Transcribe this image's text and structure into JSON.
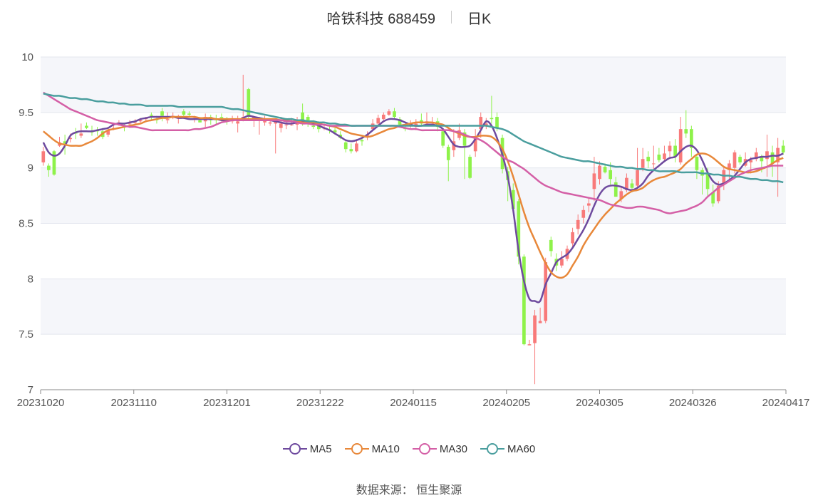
{
  "header": {
    "stock_name": "哈铁科技 688459",
    "period": "日K"
  },
  "source": {
    "label": "数据来源：",
    "value": "恒生聚源"
  },
  "chart_data": {
    "type": "candlestick",
    "y_ticks": [
      "10",
      "9.5",
      "9",
      "8.5",
      "8",
      "7.5",
      "7"
    ],
    "ylim": [
      7,
      10
    ],
    "x_ticks": [
      "20231020",
      "20231110",
      "20231201",
      "20231222",
      "20240115",
      "20240205",
      "20240305",
      "20240326",
      "20240417"
    ],
    "up_color": "#f87a7a",
    "down_color": "#8ef24a",
    "candles": [
      [
        9.05,
        9.15,
        9.19,
        9.02
      ],
      [
        9.02,
        8.98,
        9.04,
        8.92
      ],
      [
        9.15,
        8.94,
        9.16,
        8.93
      ],
      [
        9.2,
        9.23,
        9.28,
        9.19
      ],
      [
        9.24,
        9.22,
        9.3,
        9.12
      ],
      [
        9.26,
        9.27,
        9.31,
        9.23
      ],
      [
        9.32,
        9.31,
        9.36,
        9.26
      ],
      [
        9.29,
        9.31,
        9.4,
        9.27
      ],
      [
        9.38,
        9.36,
        9.41,
        9.35
      ],
      [
        9.33,
        9.32,
        9.38,
        9.29
      ],
      [
        9.34,
        9.33,
        9.37,
        9.29
      ],
      [
        9.33,
        9.28,
        9.36,
        9.26
      ],
      [
        9.3,
        9.34,
        9.37,
        9.28
      ],
      [
        9.36,
        9.36,
        9.39,
        9.34
      ],
      [
        9.41,
        9.41,
        9.43,
        9.38
      ],
      [
        9.38,
        9.37,
        9.4,
        9.33
      ],
      [
        9.4,
        9.4,
        9.43,
        9.36
      ],
      [
        9.41,
        9.41,
        9.44,
        9.38
      ],
      [
        9.42,
        9.43,
        9.45,
        9.41
      ],
      [
        9.44,
        9.45,
        9.46,
        9.42
      ],
      [
        9.48,
        9.47,
        9.5,
        9.43
      ],
      [
        9.44,
        9.43,
        9.47,
        9.4
      ],
      [
        9.51,
        9.47,
        9.54,
        9.42
      ],
      [
        9.43,
        9.44,
        9.5,
        9.4
      ],
      [
        9.47,
        9.47,
        9.5,
        9.44
      ],
      [
        9.45,
        9.45,
        9.48,
        9.4
      ],
      [
        9.51,
        9.48,
        9.53,
        9.46
      ],
      [
        9.49,
        9.48,
        9.51,
        9.47
      ],
      [
        9.45,
        9.45,
        9.47,
        9.41
      ],
      [
        9.43,
        9.41,
        9.45,
        9.41
      ],
      [
        9.42,
        9.46,
        9.49,
        9.37
      ],
      [
        9.46,
        9.43,
        9.48,
        9.39
      ],
      [
        9.44,
        9.43,
        9.48,
        9.39
      ],
      [
        9.46,
        9.45,
        9.49,
        9.42
      ],
      [
        9.44,
        9.43,
        9.46,
        9.39
      ],
      [
        9.42,
        9.43,
        9.47,
        9.4
      ],
      [
        9.4,
        9.42,
        9.47,
        9.32
      ],
      [
        9.45,
        9.46,
        9.84,
        9.42
      ],
      [
        9.71,
        9.46,
        9.72,
        9.43
      ],
      [
        9.44,
        9.46,
        9.47,
        9.37
      ],
      [
        9.44,
        9.44,
        9.46,
        9.3
      ],
      [
        9.41,
        9.43,
        9.47,
        9.38
      ],
      [
        9.4,
        9.41,
        9.44,
        9.38
      ],
      [
        9.4,
        9.42,
        9.43,
        9.13
      ],
      [
        9.36,
        9.4,
        9.46,
        9.32
      ],
      [
        9.39,
        9.39,
        9.44,
        9.35
      ],
      [
        9.39,
        9.39,
        9.45,
        9.38
      ],
      [
        9.39,
        9.43,
        9.46,
        9.34
      ],
      [
        9.5,
        9.41,
        9.58,
        9.38
      ],
      [
        9.46,
        9.4,
        9.48,
        9.37
      ],
      [
        9.38,
        9.37,
        9.43,
        9.35
      ],
      [
        9.4,
        9.35,
        9.42,
        9.32
      ],
      [
        9.36,
        9.36,
        9.4,
        9.34
      ],
      [
        9.35,
        9.34,
        9.38,
        9.31
      ],
      [
        9.34,
        9.32,
        9.36,
        9.3
      ],
      [
        9.3,
        9.27,
        9.33,
        9.26
      ],
      [
        9.23,
        9.17,
        9.25,
        9.14
      ],
      [
        9.17,
        9.15,
        9.22,
        9.13
      ],
      [
        9.15,
        9.22,
        9.26,
        9.14
      ],
      [
        9.25,
        9.24,
        9.28,
        9.2
      ],
      [
        9.29,
        9.3,
        9.33,
        9.25
      ],
      [
        9.35,
        9.4,
        9.44,
        9.34
      ],
      [
        9.4,
        9.45,
        9.48,
        9.39
      ],
      [
        9.44,
        9.48,
        9.5,
        9.43
      ],
      [
        9.48,
        9.51,
        9.53,
        9.47
      ],
      [
        9.51,
        9.46,
        9.54,
        9.44
      ],
      [
        9.44,
        9.39,
        9.46,
        9.37
      ],
      [
        9.36,
        9.35,
        9.39,
        9.33
      ],
      [
        9.4,
        9.4,
        9.43,
        9.36
      ],
      [
        9.37,
        9.4,
        9.44,
        9.34
      ],
      [
        9.43,
        9.4,
        9.49,
        9.38
      ],
      [
        9.4,
        9.42,
        9.5,
        9.38
      ],
      [
        9.4,
        9.4,
        9.46,
        9.38
      ],
      [
        9.42,
        9.37,
        9.45,
        9.33
      ],
      [
        9.33,
        9.2,
        9.36,
        9.18
      ],
      [
        9.19,
        9.07,
        9.21,
        8.88
      ],
      [
        9.16,
        9.24,
        9.35,
        9.1
      ],
      [
        9.27,
        9.34,
        9.4,
        9.25
      ],
      [
        9.32,
        9.2,
        9.35,
        8.9
      ],
      [
        9.1,
        8.91,
        9.12,
        8.9
      ],
      [
        9.15,
        9.28,
        9.35,
        9.1
      ],
      [
        9.35,
        9.46,
        9.5,
        9.27
      ],
      [
        9.38,
        9.4,
        9.45,
        9.35
      ],
      [
        9.45,
        9.44,
        9.65,
        9.4
      ],
      [
        9.46,
        9.36,
        9.5,
        9.33
      ],
      [
        9.27,
        8.99,
        9.3,
        8.95
      ],
      [
        8.97,
        8.89,
        9.01,
        8.7
      ],
      [
        8.8,
        8.63,
        8.86,
        8.6
      ],
      [
        8.7,
        8.2,
        8.72,
        8.13
      ],
      [
        8.2,
        7.41,
        8.22,
        7.4
      ],
      [
        7.4,
        7.41,
        7.45,
        7.4
      ],
      [
        7.42,
        7.67,
        7.72,
        7.05
      ],
      [
        7.6,
        7.62,
        7.74,
        7.6
      ],
      [
        7.62,
        8.15,
        8.19,
        7.6
      ],
      [
        8.35,
        8.25,
        8.38,
        8.2
      ],
      [
        8.18,
        8.12,
        8.23,
        8.07
      ],
      [
        8.12,
        8.18,
        8.25,
        8.1
      ],
      [
        8.18,
        8.27,
        8.3,
        8.16
      ],
      [
        8.32,
        8.42,
        8.46,
        8.28
      ],
      [
        8.45,
        8.53,
        8.58,
        8.4
      ],
      [
        8.55,
        8.62,
        8.66,
        8.5
      ],
      [
        8.66,
        8.68,
        8.73,
        8.6
      ],
      [
        8.81,
        8.95,
        9.1,
        8.7
      ],
      [
        8.9,
        9.02,
        9.06,
        8.85
      ],
      [
        9.01,
        8.96,
        9.04,
        8.95
      ],
      [
        8.98,
        8.9,
        9.05,
        8.85
      ],
      [
        8.87,
        8.74,
        8.92,
        8.74
      ],
      [
        8.72,
        8.79,
        8.83,
        8.69
      ],
      [
        8.8,
        8.91,
        8.95,
        8.78
      ],
      [
        8.86,
        8.82,
        8.9,
        8.78
      ],
      [
        8.84,
        8.98,
        9.18,
        8.82
      ],
      [
        9.0,
        9.08,
        9.18,
        8.97
      ],
      [
        9.1,
        9.06,
        9.15,
        9.0
      ],
      [
        9.04,
        9.04,
        9.2,
        8.99
      ],
      [
        9.12,
        9.07,
        9.18,
        9.05
      ],
      [
        9.08,
        9.13,
        9.2,
        9.06
      ],
      [
        9.15,
        9.2,
        9.24,
        9.1
      ],
      [
        9.2,
        9.1,
        9.26,
        9.05
      ],
      [
        9.05,
        9.35,
        9.46,
        9.03
      ],
      [
        9.35,
        9.31,
        9.52,
        9.27
      ],
      [
        9.35,
        9.18,
        9.38,
        9.1
      ],
      [
        9.1,
        8.98,
        9.12,
        8.9
      ],
      [
        8.98,
        8.93,
        9.0,
        8.76
      ],
      [
        8.95,
        8.81,
        9.0,
        8.75
      ],
      [
        8.78,
        8.68,
        8.85,
        8.65
      ],
      [
        8.7,
        8.84,
        8.88,
        8.68
      ],
      [
        8.85,
        8.98,
        9.01,
        8.8
      ],
      [
        8.98,
        9.04,
        9.07,
        8.9
      ],
      [
        9.0,
        9.14,
        9.16,
        8.95
      ],
      [
        9.1,
        9.05,
        9.12,
        9.03
      ],
      [
        9.02,
        9.08,
        9.14,
        9.01
      ],
      [
        9.05,
        9.07,
        9.1,
        8.95
      ],
      [
        9.08,
        9.14,
        9.18,
        9.06
      ],
      [
        9.1,
        9.06,
        9.12,
        8.96
      ],
      [
        9.08,
        9.15,
        9.3,
        8.92
      ],
      [
        9.14,
        9.04,
        9.2,
        8.92
      ],
      [
        9.05,
        9.18,
        9.27,
        8.74
      ],
      [
        9.2,
        9.14,
        9.25,
        9.12
      ]
    ],
    "series": [
      {
        "name": "MA5",
        "color": "#6e4a9e",
        "values": [
          9.23,
          9.14,
          9.11,
          9.13,
          9.2,
          9.29,
          9.32,
          9.33,
          9.33,
          9.33,
          9.34,
          9.35,
          9.36,
          9.39,
          9.4,
          9.4,
          9.41,
          9.42,
          9.44,
          9.45,
          9.46,
          9.46,
          9.46,
          9.46,
          9.46,
          9.45,
          9.45,
          9.44,
          9.44,
          9.44,
          9.44,
          9.44,
          9.44,
          9.43,
          9.43,
          9.44,
          9.43,
          9.45,
          9.47,
          9.46,
          9.45,
          9.44,
          9.43,
          9.42,
          9.41,
          9.4,
          9.4,
          9.41,
          9.42,
          9.41,
          9.4,
          9.38,
          9.36,
          9.34,
          9.31,
          9.28,
          9.25,
          9.24,
          9.25,
          9.27,
          9.3,
          9.34,
          9.38,
          9.42,
          9.44,
          9.44,
          9.43,
          9.41,
          9.39,
          9.38,
          9.38,
          9.39,
          9.39,
          9.38,
          9.35,
          9.28,
          9.21,
          9.19,
          9.19,
          9.2,
          9.26,
          9.34,
          9.42,
          9.38,
          9.27,
          9.12,
          8.92,
          8.62,
          8.25,
          7.98,
          7.82,
          7.8,
          7.8,
          7.95,
          8.05,
          8.15,
          8.19,
          8.22,
          8.28,
          8.36,
          8.44,
          8.54,
          8.66,
          8.76,
          8.82,
          8.84,
          8.84,
          8.83,
          8.81,
          8.8,
          8.82,
          8.86,
          8.93,
          8.98,
          9.02,
          9.06,
          9.09,
          9.1,
          9.15,
          9.19,
          9.2,
          9.16,
          9.07,
          8.96,
          8.88,
          8.85,
          8.86,
          8.89,
          8.93,
          8.99,
          9.05,
          9.08,
          9.09,
          9.1,
          9.1,
          9.11,
          9.11,
          9.13
        ]
      },
      {
        "name": "MA10",
        "color": "#e8883a",
        "values": [
          9.33,
          9.29,
          9.25,
          9.22,
          9.21,
          9.2,
          9.2,
          9.2,
          9.22,
          9.24,
          9.27,
          9.31,
          9.34,
          9.35,
          9.36,
          9.37,
          9.38,
          9.39,
          9.4,
          9.42,
          9.43,
          9.44,
          9.45,
          9.45,
          9.46,
          9.46,
          9.46,
          9.46,
          9.46,
          9.45,
          9.45,
          9.45,
          9.44,
          9.44,
          9.44,
          9.44,
          9.44,
          9.44,
          9.44,
          9.44,
          9.44,
          9.44,
          9.44,
          9.44,
          9.43,
          9.43,
          9.42,
          9.42,
          9.41,
          9.41,
          9.41,
          9.4,
          9.39,
          9.38,
          9.37,
          9.35,
          9.33,
          9.31,
          9.3,
          9.29,
          9.28,
          9.29,
          9.31,
          9.33,
          9.35,
          9.36,
          9.38,
          9.39,
          9.4,
          9.41,
          9.41,
          9.41,
          9.41,
          9.4,
          9.39,
          9.36,
          9.33,
          9.31,
          9.29,
          9.28,
          9.28,
          9.29,
          9.29,
          9.28,
          9.24,
          9.17,
          9.06,
          8.92,
          8.76,
          8.6,
          8.46,
          8.35,
          8.24,
          8.14,
          8.06,
          8.02,
          8.01,
          8.04,
          8.12,
          8.2,
          8.3,
          8.38,
          8.45,
          8.52,
          8.58,
          8.63,
          8.68,
          8.72,
          8.76,
          8.79,
          8.8,
          8.82,
          8.86,
          8.89,
          8.91,
          8.92,
          8.94,
          8.96,
          8.99,
          9.04,
          9.08,
          9.12,
          9.13,
          9.12,
          9.09,
          9.05,
          9.01,
          8.99,
          8.98,
          8.97,
          8.96,
          8.96,
          8.97,
          8.99,
          9.01,
          9.04,
          9.07,
          9.09
        ]
      },
      {
        "name": "MA30",
        "color": "#d45fa6",
        "values": [
          9.68,
          9.65,
          9.62,
          9.59,
          9.56,
          9.53,
          9.51,
          9.49,
          9.47,
          9.45,
          9.43,
          9.42,
          9.41,
          9.4,
          9.39,
          9.38,
          9.37,
          9.37,
          9.36,
          9.35,
          9.34,
          9.34,
          9.34,
          9.34,
          9.34,
          9.34,
          9.34,
          9.34,
          9.35,
          9.35,
          9.36,
          9.37,
          9.39,
          9.41,
          9.42,
          9.43,
          9.43,
          9.43,
          9.43,
          9.43,
          9.43,
          9.43,
          9.43,
          9.43,
          9.43,
          9.42,
          9.42,
          9.41,
          9.4,
          9.4,
          9.39,
          9.39,
          9.39,
          9.38,
          9.38,
          9.38,
          9.38,
          9.38,
          9.38,
          9.38,
          9.38,
          9.38,
          9.38,
          9.38,
          9.38,
          9.38,
          9.37,
          9.36,
          9.35,
          9.35,
          9.34,
          9.34,
          9.34,
          9.34,
          9.34,
          9.34,
          9.33,
          9.32,
          9.3,
          9.28,
          9.27,
          9.25,
          9.22,
          9.18,
          9.14,
          9.1,
          9.07,
          9.05,
          9.02,
          8.99,
          8.95,
          8.91,
          8.87,
          8.84,
          8.82,
          8.8,
          8.78,
          8.77,
          8.76,
          8.75,
          8.74,
          8.73,
          8.72,
          8.71,
          8.69,
          8.67,
          8.66,
          8.65,
          8.64,
          8.64,
          8.65,
          8.65,
          8.64,
          8.63,
          8.62,
          8.6,
          8.59,
          8.6,
          8.61,
          8.62,
          8.64,
          8.66,
          8.69,
          8.74,
          8.78,
          8.82,
          8.85,
          8.88,
          8.91,
          8.94,
          8.96,
          8.98,
          8.99,
          9.0,
          9.01,
          9.02,
          9.02,
          9.02
        ]
      },
      {
        "name": "MA60",
        "color": "#4a9e9e",
        "values": [
          9.67,
          9.66,
          9.65,
          9.65,
          9.64,
          9.63,
          9.63,
          9.62,
          9.62,
          9.61,
          9.6,
          9.6,
          9.59,
          9.59,
          9.58,
          9.58,
          9.57,
          9.57,
          9.57,
          9.56,
          9.56,
          9.56,
          9.56,
          9.56,
          9.56,
          9.55,
          9.55,
          9.55,
          9.55,
          9.55,
          9.55,
          9.55,
          9.55,
          9.55,
          9.54,
          9.53,
          9.53,
          9.52,
          9.51,
          9.5,
          9.49,
          9.48,
          9.47,
          9.46,
          9.45,
          9.44,
          9.44,
          9.43,
          9.43,
          9.42,
          9.42,
          9.41,
          9.41,
          9.4,
          9.4,
          9.39,
          9.39,
          9.38,
          9.38,
          9.38,
          9.38,
          9.38,
          9.38,
          9.38,
          9.38,
          9.38,
          9.38,
          9.38,
          9.38,
          9.38,
          9.38,
          9.38,
          9.38,
          9.38,
          9.38,
          9.38,
          9.38,
          9.38,
          9.38,
          9.38,
          9.38,
          9.38,
          9.38,
          9.37,
          9.36,
          9.35,
          9.33,
          9.3,
          9.27,
          9.24,
          9.22,
          9.2,
          9.18,
          9.16,
          9.14,
          9.12,
          9.1,
          9.09,
          9.08,
          9.07,
          9.06,
          9.06,
          9.05,
          9.04,
          9.03,
          9.02,
          9.01,
          9.01,
          9.0,
          9.0,
          8.99,
          8.99,
          8.98,
          8.98,
          8.97,
          8.97,
          8.97,
          8.97,
          8.96,
          8.96,
          8.96,
          8.96,
          8.95,
          8.95,
          8.94,
          8.94,
          8.93,
          8.93,
          8.92,
          8.92,
          8.91,
          8.9,
          8.9,
          8.89,
          8.89,
          8.88,
          8.88,
          8.87
        ]
      }
    ]
  }
}
